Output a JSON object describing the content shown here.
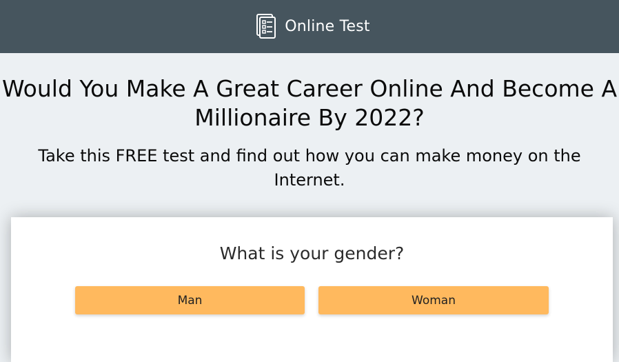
{
  "header": {
    "icon": "checklist-document-icon",
    "title": "Online Test"
  },
  "headline": "Would You Make A Great Career Online And Become A Millionaire By 2022?",
  "subheadline": "Take this FREE test and find out how you can make money on the Internet.",
  "quiz": {
    "question": "What is your gender?",
    "options": [
      "Man",
      "Woman"
    ]
  },
  "colors": {
    "header_bg": "#46555e",
    "page_bg": "#ecf0f3",
    "button_bg": "#ffb95e"
  }
}
